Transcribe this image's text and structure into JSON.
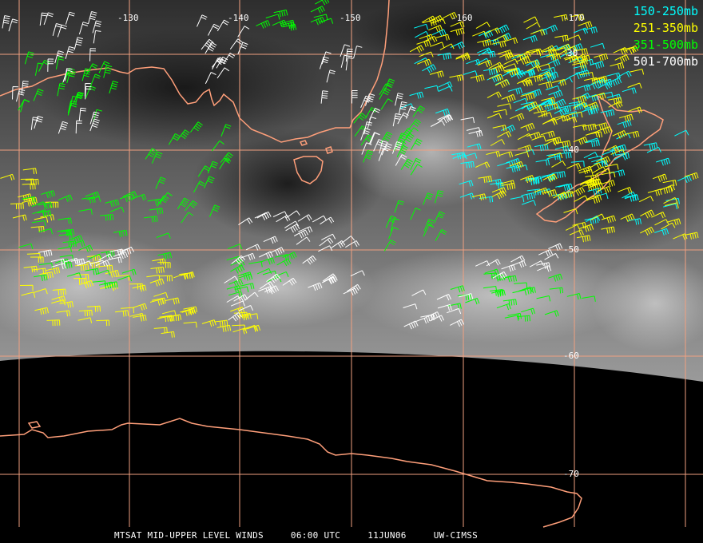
{
  "footer": {
    "satellite": "MTSAT MID-UPPER LEVEL WINDS",
    "time": "06:00 UTC",
    "date": "11JUN06",
    "source": "UW-CIMSS"
  },
  "legend": [
    {
      "label": "150-250mb",
      "color": "#00ffff"
    },
    {
      "label": "251-350mb",
      "color": "#ffff00"
    },
    {
      "label": "351-500mb",
      "color": "#00ff00"
    },
    {
      "label": "501-700mb",
      "color": "#ffffff"
    }
  ],
  "longitude_labels": [
    "-130",
    "-140",
    "-150",
    "-160",
    "-170"
  ],
  "latitude_labels": [
    "30",
    "-40",
    "-50",
    "-60",
    "-70"
  ],
  "colors": {
    "coastline": "#ff9f7a",
    "grid": "#f0a080",
    "background": "#000000"
  }
}
